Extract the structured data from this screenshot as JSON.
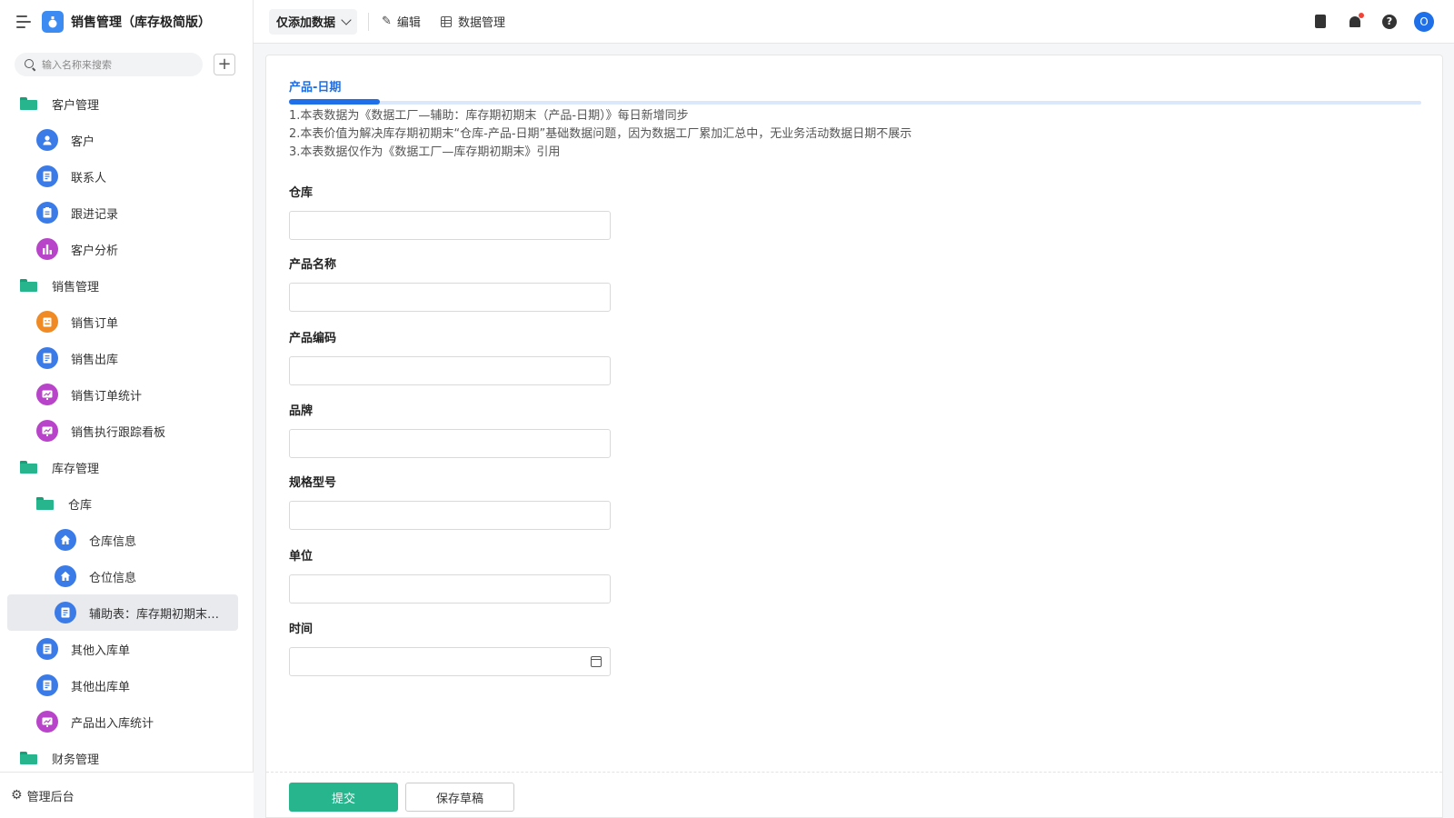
{
  "app": {
    "title": "销售管理（库存极简版）",
    "logo_icon": "app-logo-icon"
  },
  "search": {
    "placeholder": "输入名称来搜索"
  },
  "sidebar": {
    "items": [
      {
        "label": "客户管理",
        "type": "folder"
      },
      {
        "label": "客户",
        "icon": "user-icon",
        "color": "#3b7be8"
      },
      {
        "label": "联系人",
        "icon": "document-icon",
        "color": "#3b7be8"
      },
      {
        "label": "跟进记录",
        "icon": "clipboard-icon",
        "color": "#3b7be8"
      },
      {
        "label": "客户分析",
        "icon": "bar-chart-icon",
        "color": "#b845c9"
      },
      {
        "label": "销售管理",
        "type": "folder"
      },
      {
        "label": "销售订单",
        "icon": "order-icon",
        "color": "#f08a24"
      },
      {
        "label": "销售出库",
        "icon": "document-icon",
        "color": "#3b7be8"
      },
      {
        "label": "销售订单统计",
        "icon": "dashboard-icon",
        "color": "#b845c9"
      },
      {
        "label": "销售执行跟踪看板",
        "icon": "dashboard-icon",
        "color": "#b845c9"
      },
      {
        "label": "库存管理",
        "type": "folder"
      },
      {
        "label": "仓库",
        "type": "folder"
      },
      {
        "label": "仓库信息",
        "icon": "home-icon",
        "color": "#3b7be8"
      },
      {
        "label": "仓位信息",
        "icon": "home-icon",
        "color": "#3b7be8"
      },
      {
        "label": "辅助表：库存期初期末…",
        "icon": "document-icon",
        "color": "#3b7be8",
        "active": true
      },
      {
        "label": "其他入库单",
        "icon": "document-icon",
        "color": "#3b7be8"
      },
      {
        "label": "其他出库单",
        "icon": "document-icon",
        "color": "#3b7be8"
      },
      {
        "label": "产品出入库统计",
        "icon": "dashboard-icon",
        "color": "#b845c9"
      },
      {
        "label": "财务管理",
        "type": "folder"
      }
    ],
    "footer_label": "管理后台"
  },
  "toolbar": {
    "view_label": "仅添加数据",
    "edit_label": "编辑",
    "data_manage_label": "数据管理"
  },
  "form": {
    "tab_title": "产品-日期",
    "description": [
      "1.本表数据为《数据工厂—辅助：库存期初期末（产品-日期）》每日新增同步",
      "2.本表价值为解决库存期初期末“仓库-产品-日期”基础数据问题，因为数据工厂累加汇总中，无业务活动数据日期不展示",
      "3.本表数据仅作为《数据工厂—库存期初期末》引用"
    ],
    "fields": [
      {
        "label": "仓库",
        "value": ""
      },
      {
        "label": "产品名称",
        "value": ""
      },
      {
        "label": "产品编码",
        "value": ""
      },
      {
        "label": "品牌",
        "value": ""
      },
      {
        "label": "规格型号",
        "value": ""
      },
      {
        "label": "单位",
        "value": ""
      },
      {
        "label": "时间",
        "value": ""
      }
    ],
    "submit_label": "提交",
    "draft_label": "保存草稿"
  },
  "colors": {
    "accent": "#1e6fe8",
    "submit": "#26b58c",
    "folder": "#26b58c"
  },
  "user": {
    "avatar_initial": "O"
  }
}
